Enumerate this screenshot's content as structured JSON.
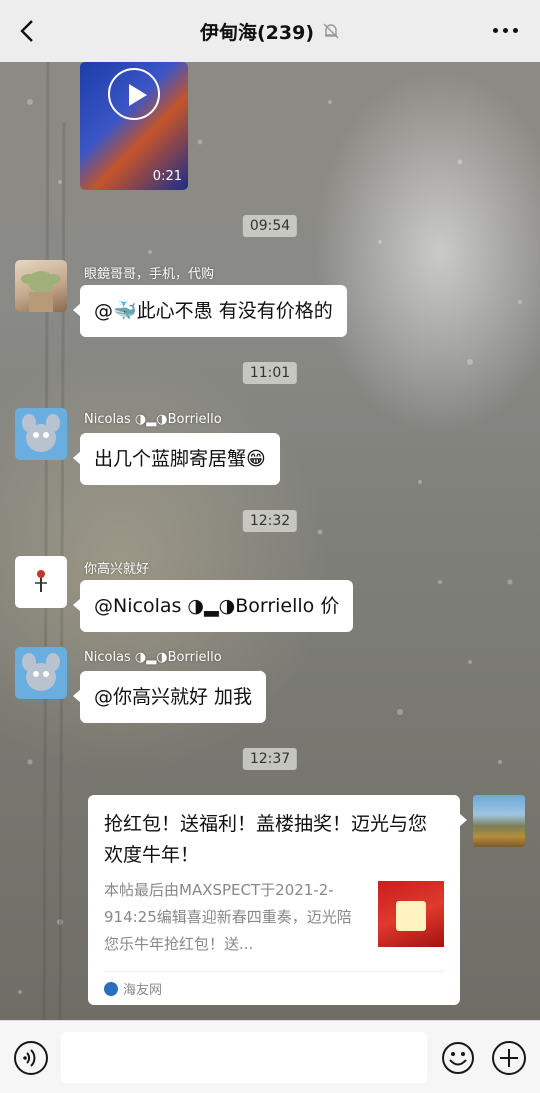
{
  "header": {
    "title": "伊甸海(239)",
    "back_icon": "chevron-left-icon",
    "mute_icon": "bell-off-icon",
    "more_icon": "more-dots-icon"
  },
  "video": {
    "duration": "0:21"
  },
  "times": [
    "09:54",
    "11:01",
    "12:32",
    "12:37"
  ],
  "messages": [
    {
      "sender": "眼鏡哥哥，手机，代购",
      "text": "@🐳此心不愚  有没有价格的"
    },
    {
      "sender": "Nicolas ◑▂◑Borriello",
      "text": "出几个蓝脚寄居蟹😁"
    },
    {
      "sender": "你高兴就好",
      "text": "@Nicolas ◑▂◑Borriello  价"
    },
    {
      "sender": "Nicolas ◑▂◑Borriello",
      "text": "@你高兴就好  加我"
    }
  ],
  "link_card": {
    "title": "抢红包！送福利！盖楼抽奖！迈光与您欢度牛年！",
    "description": "本帖最后由MAXSPECT于2021-2-914:25编辑喜迎新春四重奏，迈光陪您乐牛年抢红包！送...",
    "source": "海友网"
  },
  "bottom_bar": {
    "voice_icon": "voice-icon",
    "emoji_icon": "emoji-icon",
    "plus_icon": "plus-icon"
  }
}
